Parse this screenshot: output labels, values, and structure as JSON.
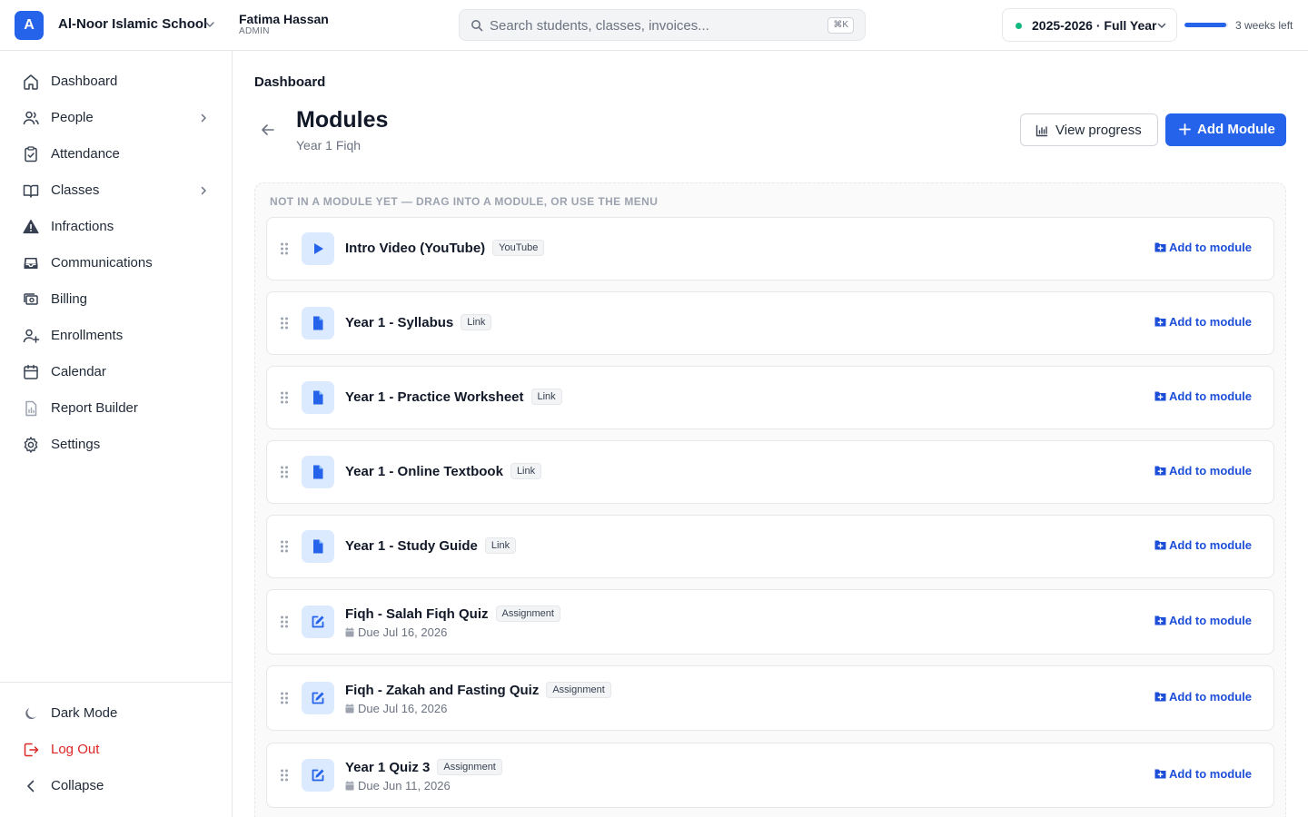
{
  "header": {
    "logo_letter": "A",
    "school_name": "Al-Noor Islamic School",
    "user_name": "Fatima Hassan",
    "user_role": "ADMIN",
    "search_placeholder": "Search students, classes, invoices...",
    "search_shortcut": "⌘K",
    "year_label": "2025-2026 · Full Year",
    "year_progress": 0.95,
    "weeks_left": "3 weeks left"
  },
  "sidebar": {
    "items": [
      {
        "label": "Dashboard",
        "icon": "home-icon"
      },
      {
        "label": "People",
        "icon": "users-icon",
        "has_children": true
      },
      {
        "label": "Attendance",
        "icon": "clipboard-check-icon"
      },
      {
        "label": "Classes",
        "icon": "book-open-icon",
        "has_children": true
      },
      {
        "label": "Infractions",
        "icon": "warning-icon"
      },
      {
        "label": "Communications",
        "icon": "inbox-icon"
      },
      {
        "label": "Billing",
        "icon": "billing-icon"
      },
      {
        "label": "Enrollments",
        "icon": "user-plus-icon"
      },
      {
        "label": "Calendar",
        "icon": "calendar-icon"
      },
      {
        "label": "Report Builder",
        "icon": "report-icon"
      },
      {
        "label": "Settings",
        "icon": "gear-icon"
      }
    ],
    "footer": {
      "dark_mode": "Dark Mode",
      "log_out": "Log Out",
      "collapse": "Collapse"
    }
  },
  "main": {
    "breadcrumb": "Dashboard",
    "title": "Modules",
    "subtitle": "Year 1 Fiqh",
    "view_progress_label": "View progress",
    "add_module_label": "Add Module",
    "unassigned_label": "NOT IN A MODULE YET — DRAG INTO A MODULE, OR USE THE MENU",
    "add_to_module_label": "Add to module",
    "items": [
      {
        "title": "Intro Video (YouTube)",
        "badge": "YouTube",
        "type": "video",
        "due": ""
      },
      {
        "title": "Year 1 - Syllabus",
        "badge": "Link",
        "type": "link",
        "due": ""
      },
      {
        "title": "Year 1 - Practice Worksheet",
        "badge": "Link",
        "type": "link",
        "due": ""
      },
      {
        "title": "Year 1 - Online Textbook",
        "badge": "Link",
        "type": "link",
        "due": ""
      },
      {
        "title": "Year 1 - Study Guide",
        "badge": "Link",
        "type": "link",
        "due": ""
      },
      {
        "title": "Fiqh - Salah Fiqh Quiz",
        "badge": "Assignment",
        "type": "assignment",
        "due": "Due Jul 16, 2026"
      },
      {
        "title": "Fiqh - Zakah and Fasting Quiz",
        "badge": "Assignment",
        "type": "assignment",
        "due": "Due Jul 16, 2026"
      },
      {
        "title": "Year 1 Quiz 3",
        "badge": "Assignment",
        "type": "assignment",
        "due": "Due Jun 11, 2026"
      }
    ]
  },
  "colors": {
    "primary": "#2563eb",
    "danger": "#dc2626",
    "success": "#10b981",
    "icon_bg": "#dbeafe"
  }
}
